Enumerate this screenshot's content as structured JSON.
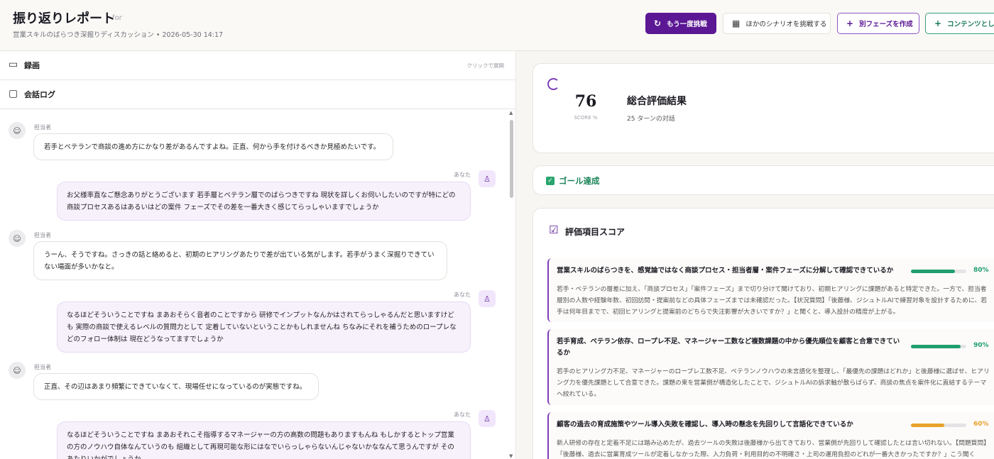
{
  "header": {
    "title": "振り返りレポート",
    "for_label": "for",
    "subtitle": "営業スキルのばらつき深掘りディスカッション • 2026-05-30 14:17",
    "buttons": {
      "retry": "もう一度挑戦",
      "other_scenario": "ほかのシナリオを挑戦する",
      "new_phase": "別フェーズを作成",
      "as_content": "コンテンツとして"
    }
  },
  "left": {
    "recording_label": "録画",
    "expand_hint": "クリックで展開",
    "log_label": "会話ログ",
    "messages": [
      {
        "speaker": "担当者",
        "text": "若手とベテランで商談の進め方にかなり差があるんですよね。正直、何から手を付けるべきか見極めたいです。"
      },
      {
        "speaker": "あなた",
        "text": "お父様率直なご懸念ありがとうございます 若手層とベテラン層でのばらつきですね 現状を詳しくお伺いしたいのですが特にどの商談プロセスあるはあるいはどの案件 フェーズでその差を一番大きく感じてらっしゃいますでしょうか"
      },
      {
        "speaker": "担当者",
        "text": "うーん、そうですね。さっきの話と絡めると、初期のヒアリングあたりで差が出ている気がします。若手がうまく深掘りできていない場面が多いかなと。"
      },
      {
        "speaker": "あなた",
        "text": "なるほどそういうことですね まあおそらく音者のことですから 研修でインプットなんかはされてらっしゃるんだと思いますけども 実際の商談で使えるレベルの質問力として 定着していないということかもしれませんね ちなみにそれを補うためのロープレなどのフォロー体制は 現在どうなってますでしょうか"
      },
      {
        "speaker": "担当者",
        "text": "正直、その辺はあまり頻繁にできていなくて、現場任せになっているのが実態ですね。"
      },
      {
        "speaker": "あなた",
        "text": "なるほどそういうことですね まあおそれこそ指導するマネージャーの方の高数の問題もありますもんね もしかするとトップ営業の方のノウハウ自体なんていうのも 組織として再現可能な形にはなでいらっしゃらないんじゃないかななんて思うんですが そのあたりいかがでしょうか"
      }
    ]
  },
  "right": {
    "score": {
      "value": "76",
      "unit": "SCORE %",
      "title": "総合評価結果",
      "turns": "25 ターンの対話"
    },
    "goal_label": "ゴール達成",
    "eval_title": "評価項目スコア",
    "items": [
      {
        "title": "営業スキルのばらつきを、感覚論ではなく商談プロセス・担当者層・案件フェーズに分解して確認できているか",
        "percent": 80,
        "percent_label": "80%",
        "color": "#1f9e6e",
        "desc": "若手・ベテランの層差に加え、「商談プロセス」「案件フェーズ」まで切り分けて聞けており、初期ヒアリングに課題があると特定できた。一方で、担当者層別の人数や経験年数、初回訪問・提案前などの具体フェーズまでは未確認だった。【状況質問】「後藤様、ジシュトルAIで練習対象を設計するために、若手は何年目までで、初回ヒアリングと提案前のどちらで失注影響が大きいですか？」と聞くと、導入設計の精度が上がる。"
      },
      {
        "title": "若手育成、ベテラン依存、ロープレ不足、マネージャー工数など複数課題の中から優先順位を顧客と合意できているか",
        "percent": 90,
        "percent_label": "90%",
        "color": "#1f9e6e",
        "desc": "若手のヒアリング力不足、マネージャーのロープレ工数不足、ベテランノウハウの未言語化を整理し、「最優先の課題はどれか」と後藤様に選ばせ、ヒアリング力を優先課題として合意できた。課題の束を営業側が構造化したことで、ジシュトルAIの訴求軸が散らばらず、商談の焦点を案件化に直結するテーマへ絞れている。"
      },
      {
        "title": "顧客の過去の育成施策やツール導入失敗を確認し、導入時の懸念を先回りして言語化できているか",
        "percent": 60,
        "percent_label": "60%",
        "color": "#e8a22a",
        "desc": "新人研修の存在と定着不足には踏み込めたが、過去ツールの失敗は後藤様から出てきており、営業側が先回りして確認したとは言い切れない。【問題質問】「後藤様、過去に営業育成ツールが定着しなかった際、入力負荷・利用目的の不明確さ・上司の運用負担のどれが一番大きかったですか？」こう聞く"
      }
    ]
  }
}
